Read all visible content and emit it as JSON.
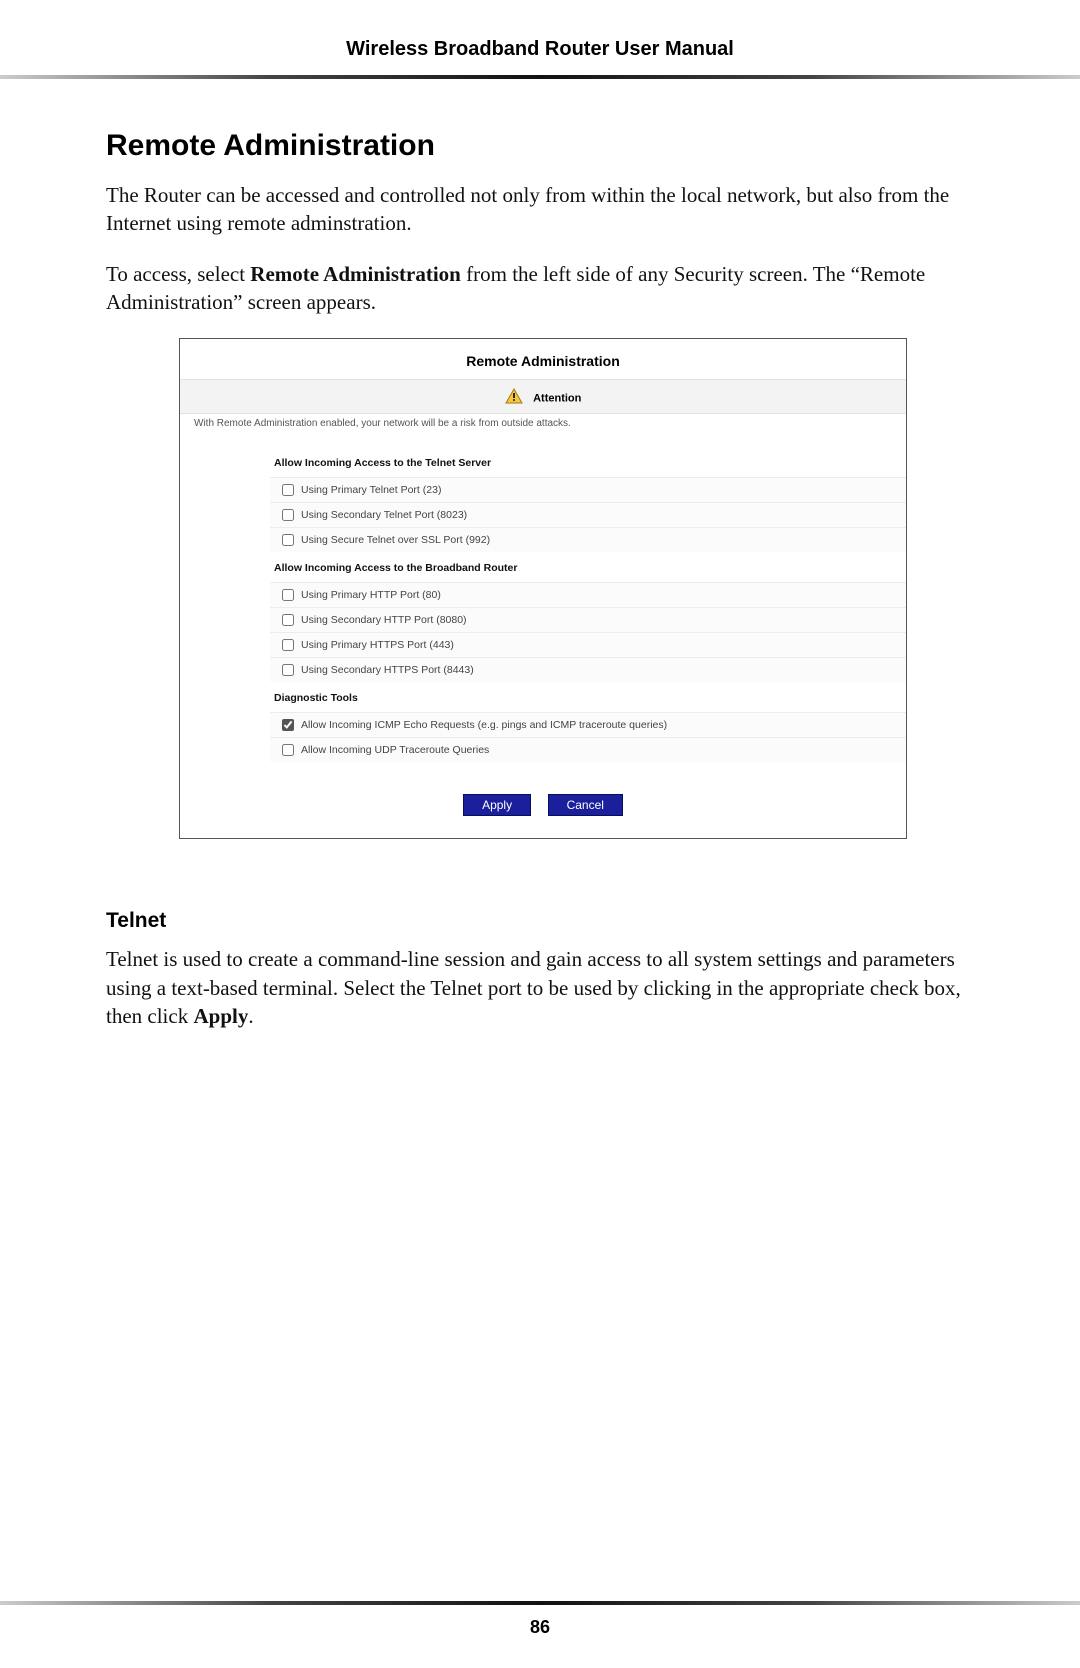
{
  "header": {
    "title": "Wireless Broadband Router User Manual"
  },
  "section": {
    "heading": "Remote Administration",
    "para1": "The Router can be accessed and controlled not only from within the local network, but also from the Internet using remote adminstration.",
    "para2_pre": "To access, select ",
    "para2_bold": "Remote Administration",
    "para2_post": " from the left side of any Security screen. The “Remote Administration” screen appears."
  },
  "panel": {
    "title": "Remote Administration",
    "attention_label": "Attention",
    "attention_text": "With Remote Administration enabled, your network will be a risk from outside attacks.",
    "group1_header": "Allow Incoming Access to the Telnet Server",
    "group1_items": [
      "Using Primary Telnet Port (23)",
      "Using Secondary Telnet Port (8023)",
      "Using Secure Telnet over SSL Port (992)"
    ],
    "group2_header": "Allow Incoming Access to the Broadband Router",
    "group2_items": [
      "Using Primary HTTP Port (80)",
      "Using Secondary HTTP Port (8080)",
      "Using Primary HTTPS Port (443)",
      "Using Secondary HTTPS Port (8443)"
    ],
    "group3_header": "Diagnostic Tools",
    "group3_item_checked": "Allow Incoming ICMP Echo Requests (e.g. pings and ICMP traceroute queries)",
    "group3_item_unchecked": "Allow Incoming UDP Traceroute Queries",
    "apply_label": "Apply",
    "cancel_label": "Cancel"
  },
  "telnet": {
    "heading": "Telnet",
    "para_pre": "Telnet is used to create a command-line session and gain access to all system settings and parameters using a text-based terminal. Select the Telnet port to be used by clicking in the appropriate check box, then click ",
    "para_bold": "Apply",
    "para_post": "."
  },
  "footer": {
    "page_number": "86"
  }
}
